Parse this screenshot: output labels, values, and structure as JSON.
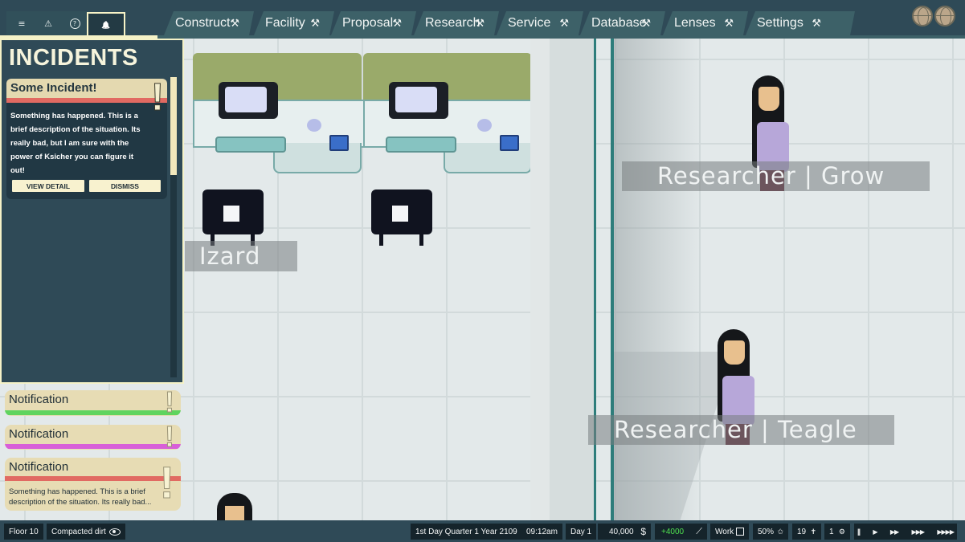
{
  "top_bar": {
    "small_tabs": [
      {
        "icon": "list-icon",
        "glyph": "≡"
      },
      {
        "icon": "warning-icon",
        "glyph": "⚠"
      },
      {
        "icon": "help-icon",
        "glyph": "?"
      },
      {
        "icon": "bell-icon",
        "glyph": "🔔"
      }
    ],
    "menu": [
      {
        "label": "Construct",
        "tool": "⚒"
      },
      {
        "label": "Facility",
        "tool": "⚒"
      },
      {
        "label": "Proposal",
        "tool": "⚒"
      },
      {
        "label": "Research",
        "tool": "⚒"
      },
      {
        "label": "Service",
        "tool": "⚒"
      },
      {
        "label": "Database",
        "tool": "⚒"
      },
      {
        "label": "Lenses",
        "tool": "⚒"
      },
      {
        "label": "Settings",
        "tool": "⚒"
      }
    ]
  },
  "incidents": {
    "title": "INCIDENTS",
    "card": {
      "title": "Some Incident!",
      "bang": "!",
      "description": "Something has happened.  This is a brief description of the situation. Its really bad, but I am sure with the power of Ksicher you can figure it out!",
      "view_detail": "VIEW DETAIL",
      "dismiss": "DISMISS"
    }
  },
  "notifications": [
    {
      "label": "Notification",
      "color": "#5fd45f",
      "bang": "!"
    },
    {
      "label": "Notification",
      "color": "#d85fd8",
      "bang": "!"
    },
    {
      "label": "Notification",
      "color": "#e16a62",
      "bang": "!",
      "description": "Something has happened.  This is a brief description of the situation. Its really bad..."
    }
  ],
  "world": {
    "name_tags": [
      "Izard",
      "Researcher |  Grow",
      "Researcher |  Teagle"
    ]
  },
  "bottom_bar": {
    "floor": "Floor 10",
    "terrain": "Compacted dirt",
    "date": "1st Day Quarter 1 Year 2109",
    "time": "09:12am",
    "day": "Day 1",
    "money": "40,000",
    "currency_symbol": "$",
    "income": "+4000",
    "mode": "Work",
    "percent": "50%",
    "count_a": "19",
    "count_b": "1",
    "speed_controls": [
      "||",
      "▶",
      "▶▶",
      "▶▶▶",
      "▶▶▶▶"
    ],
    "income_color": "#4fe04f"
  }
}
